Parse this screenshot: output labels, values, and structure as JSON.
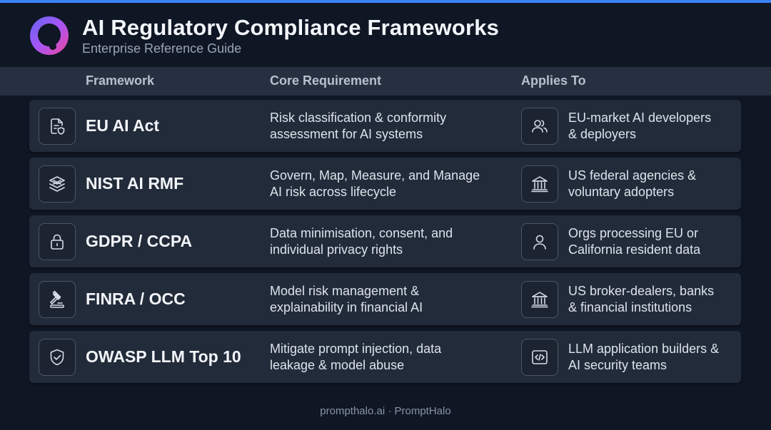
{
  "header": {
    "title": "AI Regulatory Compliance Frameworks",
    "subtitle": "Enterprise Reference Guide",
    "logo_icon": "ring-logo-icon"
  },
  "columns": {
    "framework": "Framework",
    "requirement": "Core Requirement",
    "applies": "Applies To"
  },
  "rows": [
    {
      "framework": "EU AI Act",
      "requirement": "Risk classification & conformity\nassessment for AI systems",
      "applies": "EU-market AI developers\n& deployers",
      "icon": "document-shield-icon",
      "applies_icon": "users-icon"
    },
    {
      "framework": "NIST AI RMF",
      "requirement": "Govern, Map, Measure, and Manage\nAI risk across lifecycle",
      "applies": "US federal agencies &\nvoluntary adopters",
      "icon": "layers-icon",
      "applies_icon": "government-building-icon"
    },
    {
      "framework": "GDPR / CCPA",
      "requirement": "Data minimisation, consent, and\nindividual privacy rights",
      "applies": "Orgs processing EU or\nCalifornia resident data",
      "icon": "lock-icon",
      "applies_icon": "person-icon"
    },
    {
      "framework": "FINRA / OCC",
      "requirement": "Model risk management &\nexplainability in financial AI",
      "applies": "US broker-dealers, banks\n& financial institutions",
      "icon": "gavel-icon",
      "applies_icon": "bank-icon"
    },
    {
      "framework": "OWASP LLM Top 10",
      "requirement": "Mitigate prompt injection, data\nleakage & model abuse",
      "applies": "LLM application builders &\nAI security teams",
      "icon": "shield-check-icon",
      "applies_icon": "code-icon"
    }
  ],
  "footer": {
    "text": "prompthalo.ai · PromptHalo"
  },
  "colors": {
    "accent": "#3b82f6",
    "background": "#0f1624",
    "row": "#222b39"
  }
}
